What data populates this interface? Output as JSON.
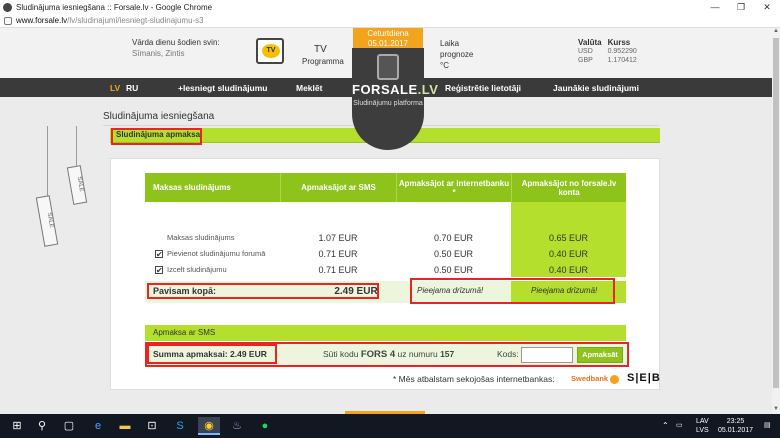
{
  "browser": {
    "window_title": "Sludinājuma iesniegšana :: Forsale.lv - Google Chrome",
    "url_host": "www.forsale.lv",
    "url_path": "/lv/sludinajumi/iesniegt-sludinajumu-s3"
  },
  "header": {
    "nameday_title": "Vārda dienu šodien svin:",
    "nameday_names": "Sīmanis, Zintis",
    "tv_title": "TV",
    "tv_sub": "Programma",
    "tv_icon_text": "TV",
    "date_day": "Ceturtdiena",
    "date": "05.01.2017",
    "logo_main": "FORSALE",
    "logo_tld": ".LV",
    "logo_sub": "Sludinājumu platforma",
    "weather_l1": "Laika",
    "weather_l2": "prognoze",
    "weather_l3": "°C",
    "currency": {
      "col1": "Valūta",
      "col2": "Kurss",
      "rows": [
        {
          "code": "USD",
          "rate": "0.952290"
        },
        {
          "code": "GBP",
          "rate": "1.170412"
        }
      ]
    }
  },
  "nav": {
    "lang_lv": "LV",
    "lang_ru": "RU",
    "submit": "+Iesniegt sludinājumu",
    "search": "Meklēt",
    "register": "Reģistrētie lietotāji",
    "newest": "Jaunākie sludinājumi"
  },
  "page": {
    "title": "Sludinājuma iesniegšana",
    "section_title": "Sludinājuma apmaksa",
    "tag_text": "SALE"
  },
  "prices": {
    "headers": [
      "Maksas sludinājums",
      "Apmaksājot ar SMS",
      "Apmaksājot ar internetbanku *",
      "Apmaksājot no forsale.lv konta"
    ],
    "rows": [
      {
        "label": "Maksas sludinājums",
        "checked": false,
        "sms": "1.07 EUR",
        "bank": "0.70 EUR",
        "account": "0.65 EUR"
      },
      {
        "label": "Pievienot sludinājumu forumā",
        "checked": true,
        "sms": "0.71 EUR",
        "bank": "0.50 EUR",
        "account": "0.40 EUR"
      },
      {
        "label": "Izcelt sludinājumu",
        "checked": true,
        "sms": "0.71 EUR",
        "bank": "0.50 EUR",
        "account": "0.40 EUR"
      }
    ],
    "total_label": "Pavisam kopā:",
    "total_sms": "2.49 EUR",
    "total_bank": "Pieejama drīzumā!",
    "total_account": "Pieejama drīzumā!"
  },
  "sms": {
    "header": "Apmaksa ar SMS",
    "sum_label": "Summa apmaksai:",
    "sum_value": "2.49 EUR",
    "send_prefix": "Sūti kodu",
    "send_code": "FORS 4",
    "send_mid": "uz numuru",
    "send_number": "157",
    "code_label": "Kods:",
    "code_value": "",
    "pay_button": "Apmaksāt"
  },
  "footer": {
    "bank_note": "* Mēs atbalstam sekojošas internetbankas:",
    "bank1": "Swedbank",
    "bank2": "S|E|B"
  },
  "taskbar": {
    "lang1": "LAV",
    "lang2": "LVS",
    "time": "23:25",
    "date": "05.01.2017"
  },
  "colors": {
    "accent_green": "#b4e02d",
    "header_green": "#8ec31b",
    "orange": "#f2a41e",
    "nav_dark": "#3a3a3a",
    "highlight_red": "#ee2222"
  }
}
